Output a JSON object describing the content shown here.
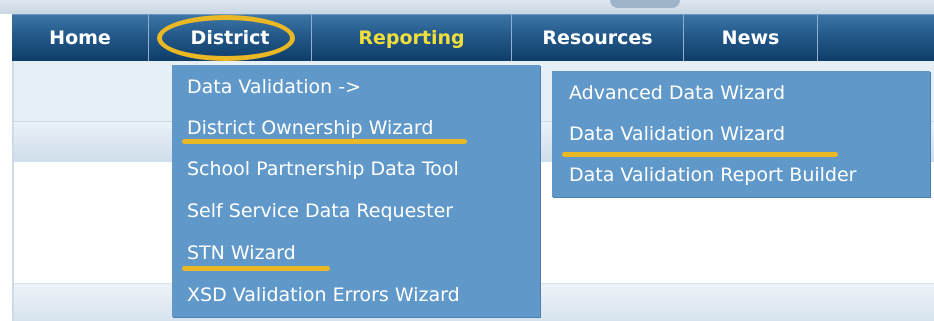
{
  "nav": {
    "items": [
      {
        "label": "Home"
      },
      {
        "label": "District"
      },
      {
        "label": "Reporting"
      },
      {
        "label": "Resources"
      },
      {
        "label": "News"
      }
    ]
  },
  "district_menu": {
    "items": [
      {
        "label": "Data Validation ->"
      },
      {
        "label": "District Ownership Wizard"
      },
      {
        "label": "School Partnership Data Tool"
      },
      {
        "label": "Self Service Data Requester"
      },
      {
        "label": "STN Wizard"
      },
      {
        "label": "XSD Validation Errors Wizard"
      }
    ]
  },
  "data_validation_submenu": {
    "items": [
      {
        "label": "Advanced Data Wizard"
      },
      {
        "label": "Data Validation Wizard"
      },
      {
        "label": "Data Validation Report Builder"
      }
    ]
  },
  "colors": {
    "highlight": "#eab824",
    "menu_bg": "#5f98c9",
    "nav_bg": "#23598a",
    "reporting_text": "#f2de3a"
  }
}
